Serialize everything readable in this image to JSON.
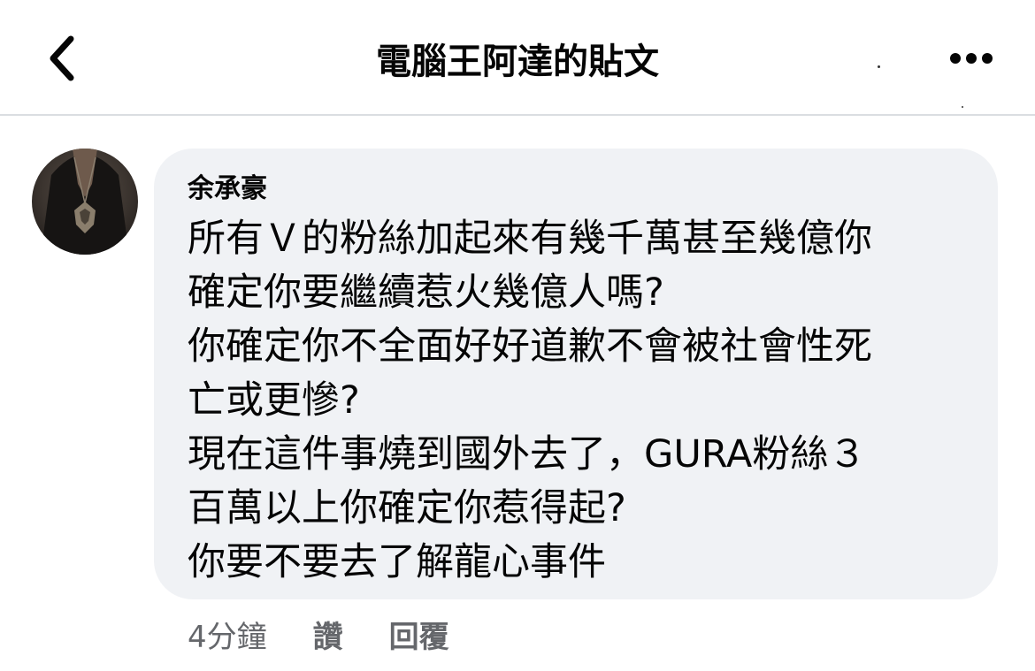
{
  "header": {
    "title": "電腦王阿達的貼文",
    "back_icon": "chevron-left-icon",
    "more_icon": "more-horizontal-icon"
  },
  "comment": {
    "author": "余承豪",
    "lines": [
      "所有Ｖ的粉絲加起來有幾千萬甚至幾億你",
      "確定你要繼續惹火幾億人嗎?",
      "你確定你不全面好好道歉不會被社會性死",
      "亡或更慘?",
      "現在這件事燒到國外去了，GURA粉絲３",
      "百萬以上你確定你惹得起?",
      "你要不要去了解龍心事件"
    ],
    "timestamp": "4分鐘",
    "like_label": "讚",
    "reply_label": "回覆"
  },
  "colors": {
    "bubble_bg": "#f0f2f5",
    "text_primary": "#050505",
    "text_secondary": "#65676b",
    "divider": "#dadde1"
  }
}
